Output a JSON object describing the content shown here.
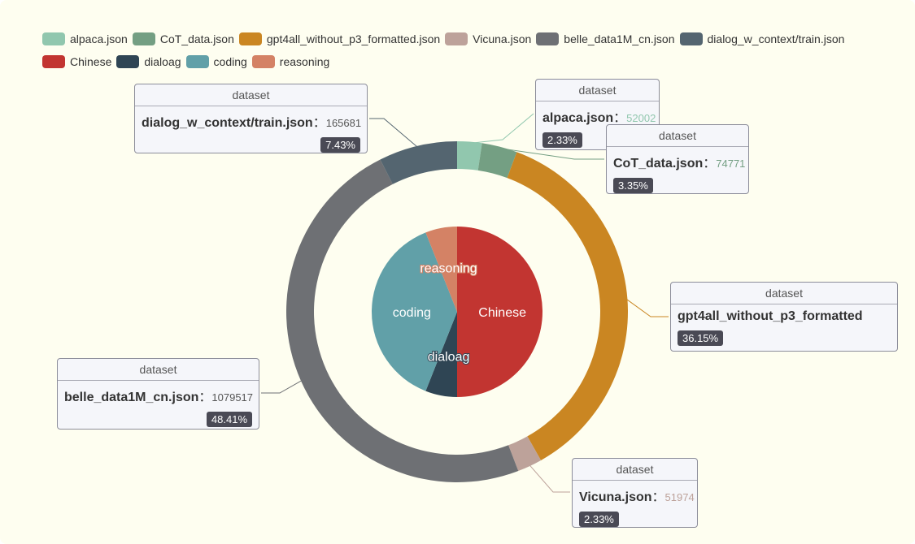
{
  "legend": {
    "rows": [
      [
        {
          "label": "alpaca.json",
          "color": "#91c7ae"
        },
        {
          "label": "CoT_data.json",
          "color": "#749f83"
        },
        {
          "label": "gpt4all_without_p3_formatted.json",
          "color": "#ca8622"
        },
        {
          "label": "Vicuna.json",
          "color": "#bda29a"
        },
        {
          "label": "belle_data1M_cn.json",
          "color": "#6e7074"
        },
        {
          "label": "dialog_w_context/train.json",
          "color": "#546570"
        }
      ],
      [
        {
          "label": "Chinese",
          "color": "#c23531"
        },
        {
          "label": "dialoag",
          "color": "#2f4554"
        },
        {
          "label": "coding",
          "color": "#61a0a8"
        },
        {
          "label": "reasoning",
          "color": "#d48265"
        }
      ]
    ]
  },
  "chart_data": {
    "type": "pie",
    "series": [
      {
        "name": "dataset",
        "kind": "donut",
        "slices": [
          {
            "label": "alpaca.json",
            "value": 52002,
            "percent": "2.33%",
            "color": "#91c7ae"
          },
          {
            "label": "CoT_data.json",
            "value": 74771,
            "percent": "3.35%",
            "color": "#749f83"
          },
          {
            "label": "gpt4all_without_p3_formatted.json",
            "value": 806199,
            "percent": "36.15%",
            "color": "#ca8622"
          },
          {
            "label": "Vicuna.json",
            "value": 51974,
            "percent": "2.33%",
            "color": "#bda29a"
          },
          {
            "label": "belle_data1M_cn.json",
            "value": 1079517,
            "percent": "48.41%",
            "color": "#6e7074"
          },
          {
            "label": "dialog_w_context/train.json",
            "value": 165681,
            "percent": "7.43%",
            "color": "#546570"
          }
        ]
      },
      {
        "kind": "pie",
        "slices": [
          {
            "label": "Chinese",
            "value": 50,
            "color": "#c23531"
          },
          {
            "label": "dialoag",
            "value": 6,
            "color": "#2f4554"
          },
          {
            "label": "coding",
            "value": 38,
            "color": "#61a0a8"
          },
          {
            "label": "reasoning",
            "value": 6,
            "color": "#d48265"
          }
        ]
      }
    ],
    "callouts": [
      {
        "series_name": "dataset",
        "name": "alpaca.json",
        "value": "52002",
        "percent": "2.33%",
        "color": "#91c7ae"
      },
      {
        "series_name": "dataset",
        "name": "CoT_data.json",
        "value": "74771",
        "percent": "3.35%",
        "color": "#749f83"
      },
      {
        "series_name": "dataset",
        "name": "gpt4all_without_p3_formatted",
        "value": "",
        "percent": "36.15%",
        "color": "#ca8622"
      },
      {
        "series_name": "dataset",
        "name": "Vicuna.json",
        "value": "51974",
        "percent": "2.33%",
        "color": "#bda29a"
      },
      {
        "series_name": "dataset",
        "name": "belle_data1M_cn.json",
        "value": "1079517",
        "percent": "48.41%",
        "color": "#6e7074"
      },
      {
        "series_name": "dataset",
        "name": "dialog_w_context/train.json",
        "value": "165681",
        "percent": "7.43%",
        "color": "#546570"
      }
    ],
    "separator": "："
  }
}
